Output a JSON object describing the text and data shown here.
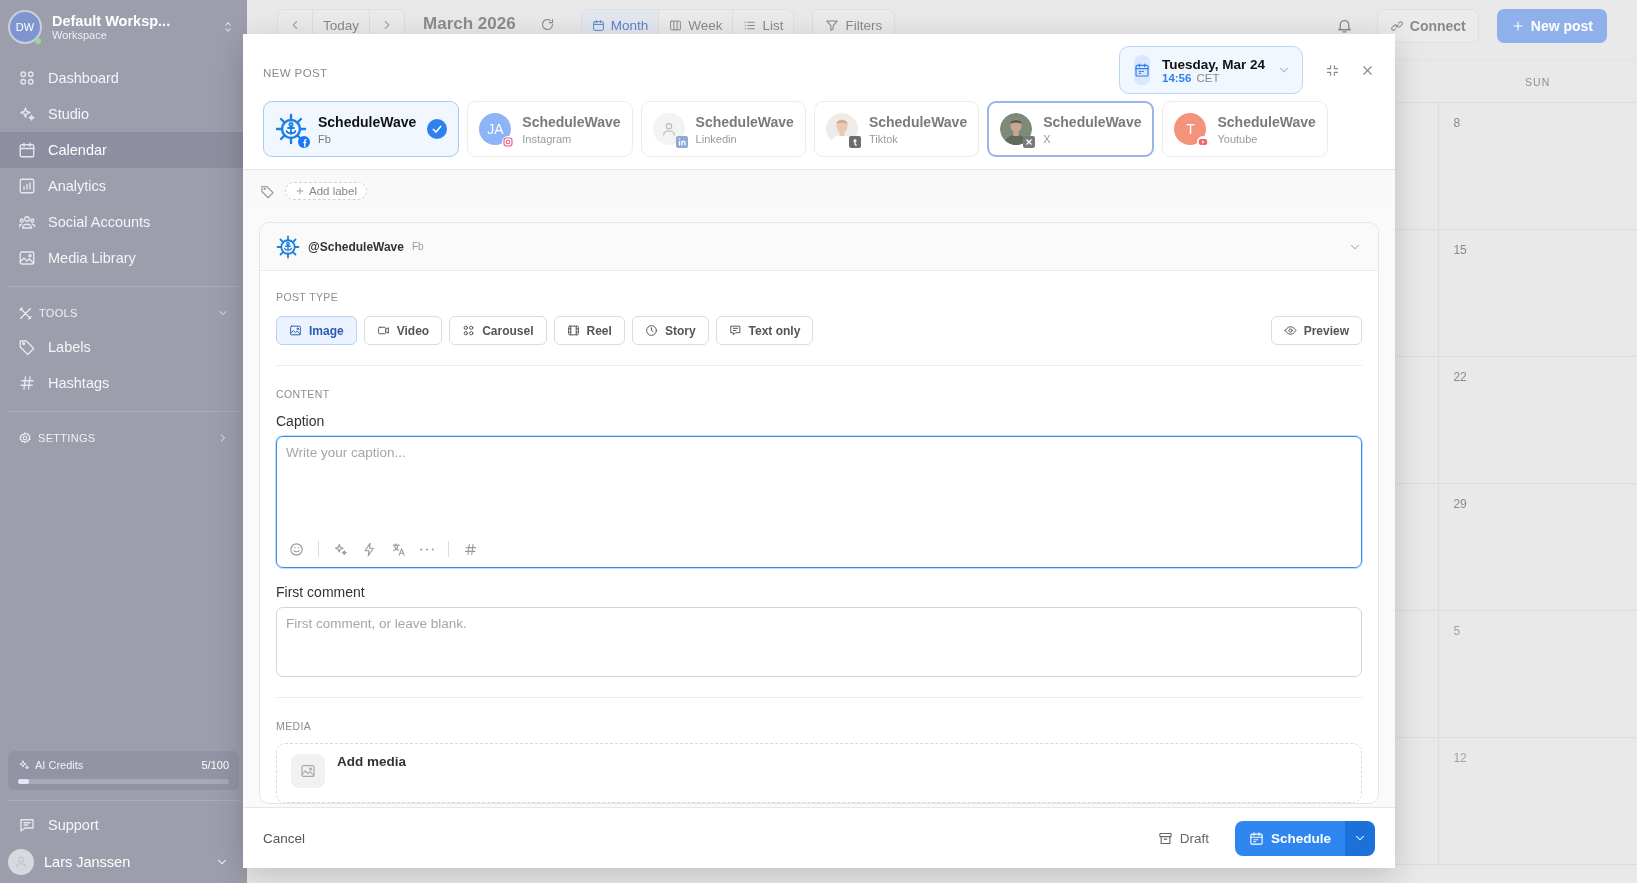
{
  "sidebar": {
    "workspace": {
      "initials": "DW",
      "name": "Default Worksp...",
      "subtitle": "Workspace",
      "online": true
    },
    "nav": [
      {
        "label": "Dashboard",
        "selected": false
      },
      {
        "label": "Studio",
        "selected": false
      },
      {
        "label": "Calendar",
        "selected": true
      },
      {
        "label": "Analytics",
        "selected": false
      },
      {
        "label": "Social Accounts",
        "selected": false
      },
      {
        "label": "Media Library",
        "selected": false
      }
    ],
    "tools": {
      "title": "TOOLS",
      "expanded": true,
      "items": [
        {
          "label": "Labels"
        },
        {
          "label": "Hashtags"
        }
      ]
    },
    "settings": {
      "title": "SETTINGS",
      "expanded": false
    },
    "credits": {
      "label": "AI Credits",
      "count": "5/100",
      "level": 0.05
    },
    "support": "Support",
    "user": {
      "name": "Lars Janssen"
    }
  },
  "topbar": {
    "today": "Today",
    "month": "March 2026",
    "views": [
      {
        "label": "Month",
        "selected": true
      },
      {
        "label": "Week",
        "selected": false
      },
      {
        "label": "List",
        "selected": false
      }
    ],
    "filters": "Filters",
    "connect": "Connect",
    "new_post": "New post"
  },
  "calendar": {
    "weekday": "SUN",
    "days": [
      {
        "label": "8",
        "outside_month": false
      },
      {
        "label": "15",
        "outside_month": false
      },
      {
        "label": "22",
        "outside_month": false
      },
      {
        "label": "29",
        "outside_month": false
      },
      {
        "label": "5",
        "outside_month": true
      },
      {
        "label": "12",
        "outside_month": true
      }
    ]
  },
  "modal": {
    "title": "NEW POST",
    "date": {
      "day": "Tuesday, Mar 24",
      "time": "14:56",
      "zone": "CET"
    },
    "accounts": [
      {
        "name": "ScheduleWave",
        "platform": "Fb",
        "kind": "logo",
        "badge": {
          "kind": "facebook"
        },
        "selected": true,
        "focused": false
      },
      {
        "name": "ScheduleWave",
        "platform": "Instagram",
        "kind": "initials",
        "initials": "JA",
        "color": "#8db4f6",
        "badge": {
          "kind": "instagram"
        },
        "selected": false,
        "focused": false
      },
      {
        "name": "ScheduleWave",
        "platform": "Linkedin",
        "kind": "placeholder",
        "badge": {
          "kind": "linkedin"
        },
        "selected": false,
        "focused": false
      },
      {
        "name": "ScheduleWave",
        "platform": "Tiktok",
        "badge": {
          "kind": "tiktok"
        },
        "selected": false,
        "focused": false
      },
      {
        "name": "ScheduleWave",
        "platform": "X",
        "badge": {
          "kind": "x"
        },
        "selected": false,
        "focused": true
      },
      {
        "name": "ScheduleWave",
        "platform": "Youtube",
        "kind": "initials",
        "initials": "T",
        "color": "#f4937c",
        "badge": {
          "kind": "youtube"
        },
        "selected": false,
        "focused": false
      }
    ],
    "add_label": "Add label",
    "profile": {
      "handle": "@ScheduleWave",
      "platform": "Fb",
      "expanded": true
    },
    "post_type": {
      "title": "POST TYPE",
      "types": [
        {
          "label": "Image",
          "selected": true
        },
        {
          "label": "Video",
          "selected": false
        },
        {
          "label": "Carousel",
          "selected": false
        },
        {
          "label": "Reel",
          "selected": false
        },
        {
          "label": "Story",
          "selected": false
        },
        {
          "label": "Text only",
          "selected": false
        }
      ],
      "preview": "Preview"
    },
    "content": {
      "title": "CONTENT",
      "caption": {
        "label": "Caption",
        "placeholder": "Write your caption...",
        "focused": true
      },
      "first_comment": {
        "label": "First comment",
        "placeholder": "First comment, or leave blank."
      }
    },
    "media": {
      "title": "MEDIA",
      "add": "Add media"
    },
    "footer": {
      "cancel": "Cancel",
      "draft": "Draft",
      "schedule": "Schedule"
    }
  }
}
